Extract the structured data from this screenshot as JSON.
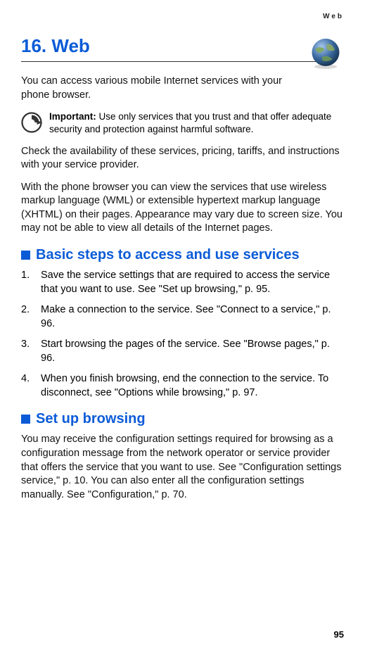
{
  "header_label": "Web",
  "chapter_title": "16. Web",
  "globe_icon_name": "globe-icon",
  "intro": "You can access various mobile Internet services with your phone browser.",
  "important": {
    "label": "Important:",
    "text": "Use only services that you trust and that offer adequate security and protection against harmful software."
  },
  "para1": "Check the availability of these services, pricing, tariffs, and instructions with your service provider.",
  "para2": "With the phone browser you can view the services that use wireless markup language (WML) or extensible hypertext markup language (XHTML) on their pages. Appearance may vary due to screen size. You may not be able to view all details of the Internet pages.",
  "section1": {
    "title": "Basic steps to access and use services",
    "items": [
      "Save the service settings that are required to access the service that you want to use. See \"Set up browsing,\" p. 95.",
      "Make a connection to the service. See \"Connect to a service,\" p. 96.",
      "Start browsing the pages of the service. See \"Browse pages,\" p. 96.",
      "When you finish browsing, end the connection to the service. To disconnect, see \"Options while browsing,\" p. 97."
    ]
  },
  "section2": {
    "title": "Set up browsing",
    "body": "You may receive the configuration settings required for browsing as a configuration message from the network operator or service provider that offers the service that you want to use. See \"Configuration settings service,\" p. 10. You can also enter all the configuration settings manually. See \"Configuration,\" p. 70."
  },
  "page_number": "95"
}
